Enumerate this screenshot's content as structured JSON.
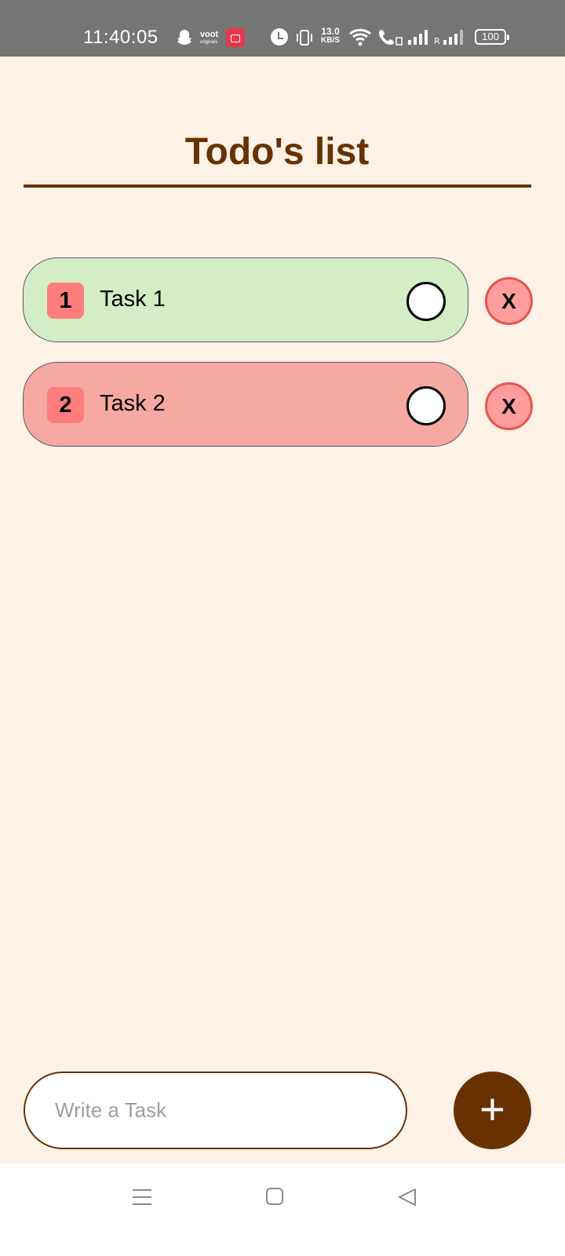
{
  "status_bar": {
    "time": "11:40:05",
    "net_speed_value": "13.0",
    "net_speed_unit": "KB/S",
    "battery": "100",
    "icons": [
      "snapchat-ghost-icon",
      "voot-icon",
      "screen-record-icon",
      "alarm-icon",
      "vibrate-icon",
      "wifi-icon",
      "volte-call-icon",
      "signal-icon",
      "signal-roaming-icon",
      "battery-icon"
    ]
  },
  "header": {
    "title": "Todo's list"
  },
  "tasks": [
    {
      "number": "1",
      "label": "Task 1",
      "bg_color": "#d3edc4",
      "done": false,
      "delete_label": "X"
    },
    {
      "number": "2",
      "label": "Task 2",
      "bg_color": "#f6a9a1",
      "done": false,
      "delete_label": "X"
    }
  ],
  "input": {
    "placeholder": "Write a Task",
    "value": ""
  },
  "add_button": {
    "label": "+"
  },
  "colors": {
    "background": "#fef1e6",
    "accent": "#673200",
    "badge": "#ff7d7d",
    "delete_bg": "#ff9d9d",
    "delete_border": "#e8534f"
  },
  "nav_bar": {
    "icons": [
      "menu-icon",
      "home-icon",
      "back-icon"
    ]
  }
}
